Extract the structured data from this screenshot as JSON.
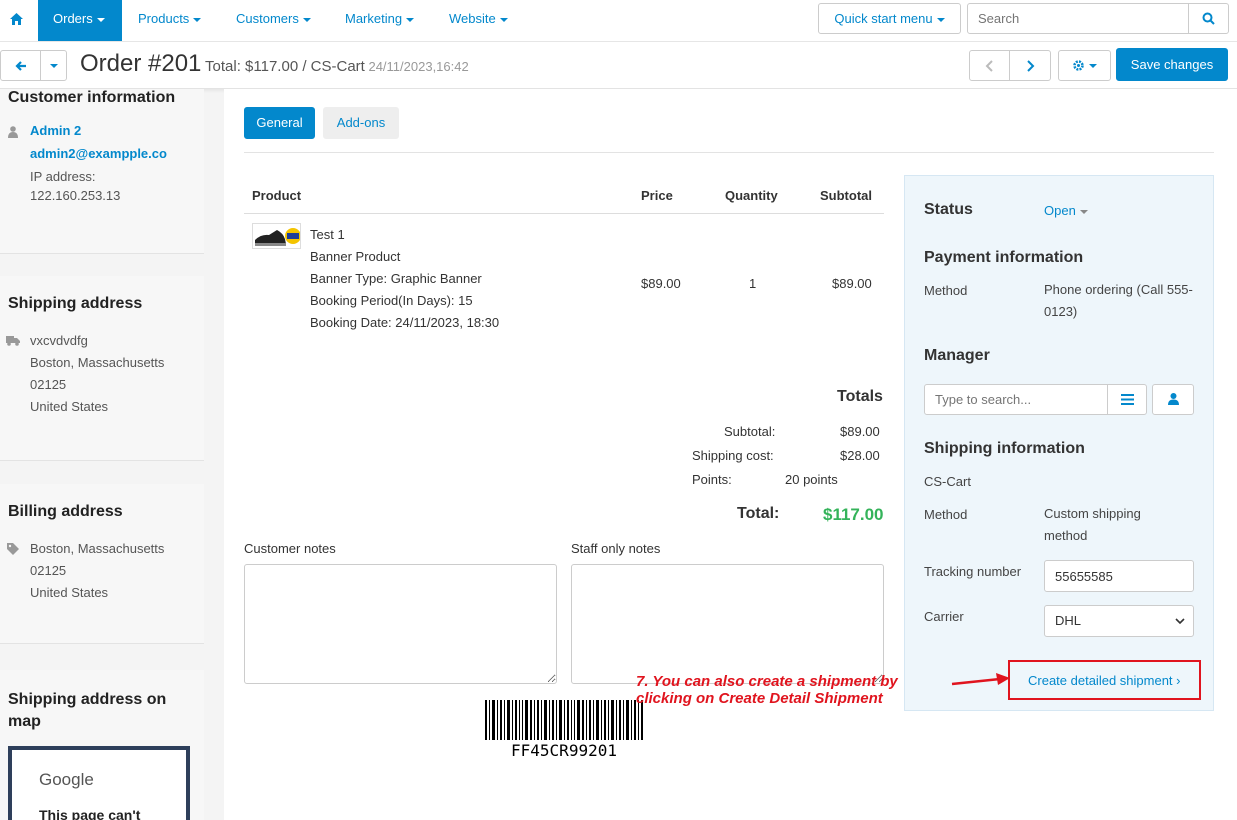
{
  "nav": {
    "home_icon": "home-icon",
    "items": [
      {
        "label": "Orders"
      },
      {
        "label": "Products"
      },
      {
        "label": "Customers"
      },
      {
        "label": "Marketing"
      },
      {
        "label": "Website"
      }
    ],
    "quick_start": "Quick start menu",
    "search_placeholder": "Search"
  },
  "header": {
    "order_title": "Order #201",
    "summary": "Total: $117.00 / CS-Cart",
    "date": "24/11/2023,16:42",
    "save_label": "Save changes"
  },
  "sidebar": {
    "customer": {
      "title": "Customer information",
      "name": "Admin 2",
      "email": "admin2@exampple.co",
      "ip_label": "IP address:",
      "ip": "122.160.253.13"
    },
    "shipping": {
      "title": "Shipping address",
      "line1": "vxcvdvdfg",
      "line2": "Boston, Massachusetts",
      "line3": "02125",
      "line4": "United States"
    },
    "billing": {
      "title": "Billing address",
      "line1": "Boston, Massachusetts",
      "line2": "02125",
      "line3": "United States"
    },
    "map": {
      "title": "Shipping address on map",
      "google": "Google",
      "message": "This page can't"
    }
  },
  "tabs": [
    {
      "label": "General",
      "active": true
    },
    {
      "label": "Add-ons",
      "active": false
    }
  ],
  "table": {
    "headers": {
      "product": "Product",
      "price": "Price",
      "quantity": "Quantity",
      "subtotal": "Subtotal"
    },
    "row": {
      "name": "Test 1",
      "details": [
        "Banner Product",
        "Banner Type: Graphic Banner",
        "Booking Period(In Days): 15",
        "Booking Date: 24/11/2023, 18:30"
      ],
      "price": "$89.00",
      "quantity": "1",
      "subtotal": "$89.00"
    }
  },
  "totals": {
    "title": "Totals",
    "subtotal_label": "Subtotal:",
    "subtotal": "$89.00",
    "shipping_label": "Shipping cost:",
    "shipping": "$28.00",
    "points_label": "Points:",
    "points": "20 points",
    "total_label": "Total:",
    "total": "$117.00",
    "total_color": "#34b35a"
  },
  "notes": {
    "customer_label": "Customer notes",
    "staff_label": "Staff only notes"
  },
  "barcode": {
    "code": "FF45CR99201"
  },
  "panel": {
    "status_title": "Status",
    "status_value": "Open",
    "payment_title": "Payment information",
    "method_label": "Method",
    "payment_method": "Phone ordering (Call 555-0123)",
    "manager_title": "Manager",
    "manager_placeholder": "Type to search...",
    "shipping_title": "Shipping information",
    "shipping_company": "CS-Cart",
    "shipping_method_label": "Method",
    "shipping_method": "Custom shipping method",
    "tracking_label": "Tracking number",
    "tracking_value": "55655585",
    "carrier_label": "Carrier",
    "carrier_value": "DHL",
    "create_shipment": "Create detailed shipment"
  },
  "annotation": {
    "line1": "7. You can also create a shipment by",
    "line2": "clicking on Create Detail Shipment",
    "color": "#e0141e"
  },
  "colors": {
    "primary": "#0388cc"
  }
}
